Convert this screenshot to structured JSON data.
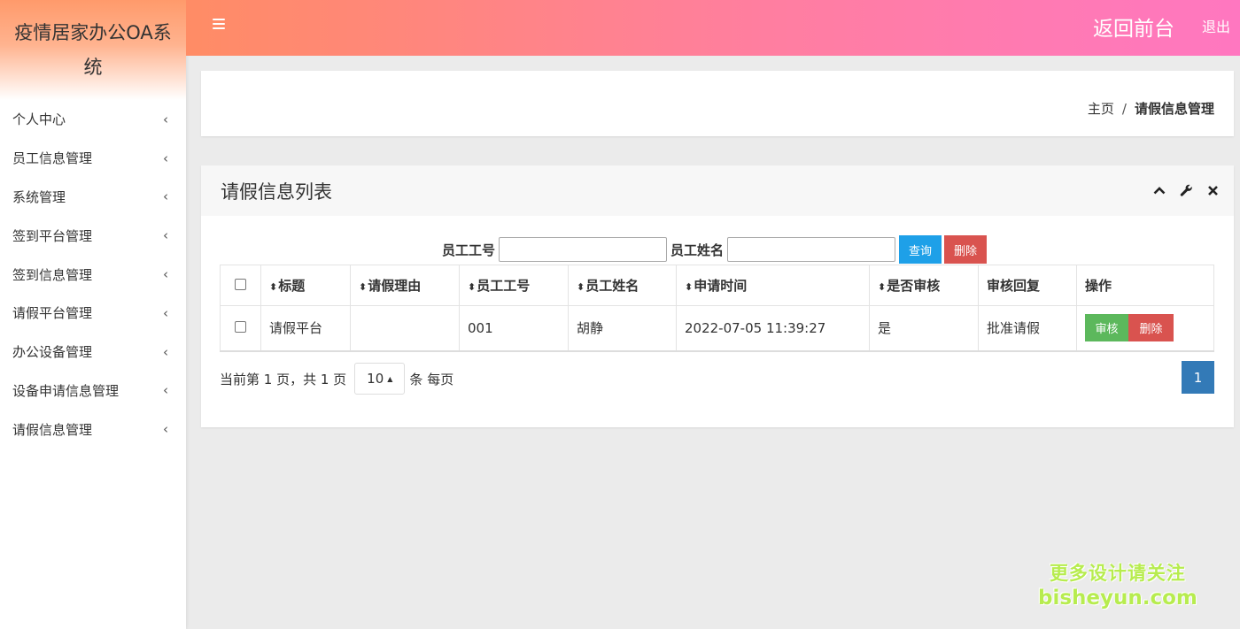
{
  "app": {
    "title": "疫情居家办公OA系统"
  },
  "sidebar": {
    "items": [
      {
        "label": "个人中心"
      },
      {
        "label": "员工信息管理"
      },
      {
        "label": "系统管理"
      },
      {
        "label": "签到平台管理"
      },
      {
        "label": "签到信息管理"
      },
      {
        "label": "请假平台管理"
      },
      {
        "label": "办公设备管理"
      },
      {
        "label": "设备申请信息管理"
      },
      {
        "label": "请假信息管理"
      }
    ],
    "chevron": "‹"
  },
  "topbar": {
    "back_front": "返回前台",
    "logout": "退出",
    "menu_icon": "hamburger-icon"
  },
  "breadcrumb": {
    "home": "主页",
    "separator": "/",
    "current": "请假信息管理"
  },
  "card": {
    "title": "请假信息列表",
    "tools": [
      "chevron-up-icon",
      "wrench-icon",
      "close-icon"
    ]
  },
  "search": {
    "emp_no_label": "员工工号",
    "emp_no_value": "",
    "emp_name_label": "员工姓名",
    "emp_name_value": "",
    "query_button": "查询",
    "delete_button": "删除"
  },
  "table": {
    "sort_glyph": "⬍",
    "columns": [
      "标题",
      "请假理由",
      "员工工号",
      "员工姓名",
      "申请时间",
      "是否审核",
      "审核回复",
      "操作"
    ],
    "rows": [
      {
        "title": "请假平台",
        "reason": "",
        "emp_no": "001",
        "emp_name": "胡静",
        "apply_time": "2022-07-05 11:39:27",
        "reviewed": "是",
        "reply": "批准请假",
        "approve_label": "审核",
        "delete_label": "删除"
      }
    ]
  },
  "pagination": {
    "info_prefix": "当前第 1 页，共 1 页",
    "page_size": "10",
    "info_suffix": "条 每页",
    "current_page": "1"
  },
  "watermark": {
    "line1": "更多设计请关注",
    "line2": "bisheyun.com"
  },
  "colors": {
    "topbar_gradient_start": "#ff8c65",
    "topbar_gradient_end": "#ff77c0",
    "query_button": "#1ea0e8",
    "delete_button": "#d9534f",
    "approve_button": "#5cb85c",
    "page_active": "#337ab7",
    "watermark": "#b7ec4f"
  }
}
